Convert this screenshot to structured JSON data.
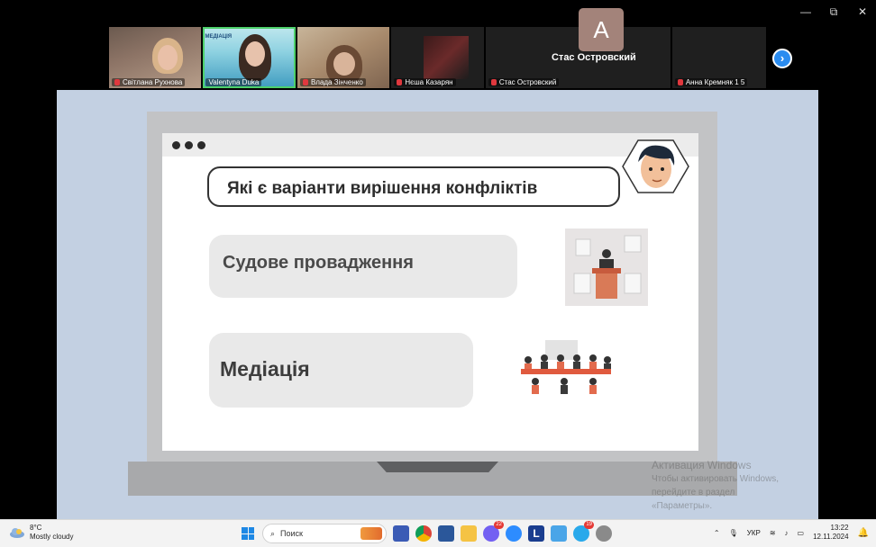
{
  "window": {
    "minimize": "—",
    "restore": "⧉",
    "close": "✕"
  },
  "participants": [
    {
      "name": "Світлана Рухнова"
    },
    {
      "name": "Valentyna Duka",
      "share_thumb_title": "МЕДІАЦІЯ"
    },
    {
      "name": "Влада Зінченко"
    },
    {
      "name": "Нєша Казарян"
    },
    {
      "name": "Стас Островский",
      "display": "Стас Островский"
    },
    {
      "name": "Анна Кремняк 1 5",
      "avatar_letter": "A"
    }
  ],
  "slide": {
    "question": "Які є варіанти вирішення конфліктів",
    "option1": "Судове провадження",
    "option2": "Медіація"
  },
  "watermark": {
    "line1": "Активация Windows",
    "line2": "Чтобы активировать Windows, перейдите в раздел",
    "line3": "«Параметры»."
  },
  "taskbar": {
    "temperature": "8°C",
    "weather": "Mostly cloudy",
    "search_placeholder": "Поиск",
    "badge_viber": "22",
    "badge_telegram": "19",
    "lang": "УКР",
    "time": "13:22",
    "date": "12.11.2024"
  },
  "colors": {
    "accent": "#2a8cf0",
    "active_speaker": "#4ed06b",
    "muted": "#e0383e"
  }
}
